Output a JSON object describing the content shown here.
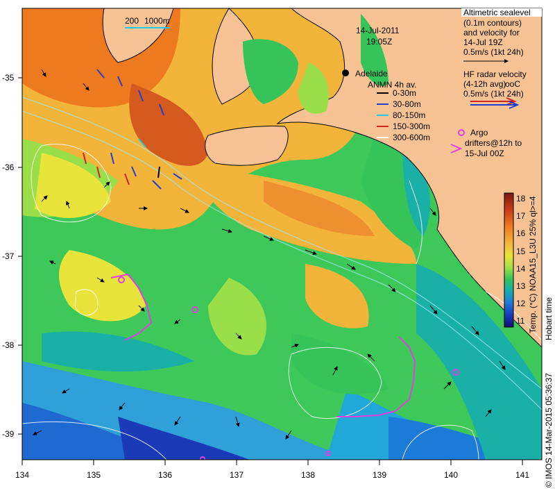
{
  "header": {
    "date": "14-Jul-2011",
    "time": "19:05Z"
  },
  "scale_bar": {
    "left_label": "200",
    "right_label": "1000m"
  },
  "city": {
    "name": "Adelaide"
  },
  "altimetry_legend": {
    "lines": [
      "Altimetric sealevel",
      "(0.1m contours)",
      "and velocity for",
      "14-Jul 19Z",
      "0.5m/s (1kt 24h)"
    ]
  },
  "hf_radar_legend": {
    "lines": [
      "HF radar velocity",
      "(4-12h avg)",
      "0.5m/s (1kt 24h)"
    ],
    "overlay_text": "ooC"
  },
  "anmn_legend": {
    "title": "ANMN 4h av.",
    "items": [
      {
        "label": "0-30m",
        "color": "#000000"
      },
      {
        "label": "30-80m",
        "color": "#1f3fd0"
      },
      {
        "label": "80-150m",
        "color": "#22c8e8"
      },
      {
        "label": "150-300m",
        "color": "#d42020"
      },
      {
        "label": "300-600m",
        "color": "#ffffff"
      }
    ]
  },
  "argo_legend": {
    "lines": [
      "Argo",
      "drifters@12h to",
      "15-Jul 00Z"
    ],
    "color": "#e040e0"
  },
  "colorbar": {
    "ticks": [
      "18",
      "17",
      "16",
      "15",
      "14",
      "13",
      "12",
      "11"
    ],
    "label": "Temp. (°C) NOAA15_L3U 25% ql>=4",
    "side_label": "Hobart time",
    "colors": [
      "#7a1a10",
      "#c83a18",
      "#ee7a20",
      "#f2b43a",
      "#e8e43c",
      "#9ade4a",
      "#36c45a",
      "#1ab0a8",
      "#1c7ad8",
      "#1a3ab8",
      "#0c1470"
    ]
  },
  "axes": {
    "x_ticks": [
      "134",
      "135",
      "136",
      "137",
      "138",
      "139",
      "140",
      "141"
    ],
    "y_ticks": [
      "-35",
      "-36",
      "-37",
      "-38",
      "-39"
    ]
  },
  "credit": "© IMOS 14-Mar-2015 05:36:37",
  "colors": {
    "land": "#f7c294",
    "coast": "#000000",
    "argo": "#e040e0"
  }
}
